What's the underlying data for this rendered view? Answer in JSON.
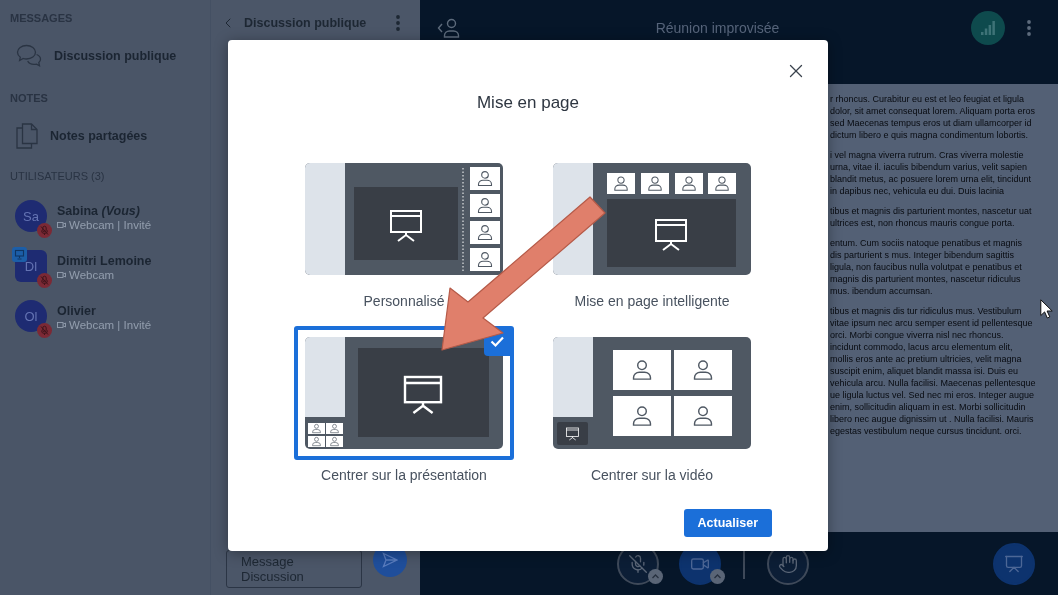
{
  "sidebar": {
    "sections": [
      {
        "title": "MESSAGES",
        "items": [
          {
            "kind": "chat",
            "label": "Discussion publique"
          }
        ]
      },
      {
        "title": "NOTES",
        "items": [
          {
            "kind": "notes",
            "label": "Notes partagées"
          }
        ]
      }
    ],
    "users_title": "UTILISATEURS (3)",
    "users": [
      {
        "initials": "Sa",
        "name": "Sabina *(Vous)*",
        "status": "Webcam | Invité",
        "moderator": false,
        "presenter": false,
        "muted": true
      },
      {
        "initials": "Dl",
        "name": "Dimitri Lemoine",
        "status": "Webcam",
        "moderator": true,
        "presenter": true,
        "muted": true
      },
      {
        "initials": "Ol",
        "name": "Olivier",
        "status": "Webcam | Invité",
        "moderator": false,
        "presenter": false,
        "muted": true
      }
    ]
  },
  "chat": {
    "title": "Discussion publique",
    "input": {
      "placeholder": "Message Discussion"
    }
  },
  "meeting": {
    "title": "Réunion improvisée"
  },
  "presentation": {
    "paragraphs": [
      "r rhoncus. Curabitur eu est et leo feugiat et ligula dolor, sit amet consequat lorem. Aliquam porta eros sed Maecenas tempus eros ut diam ullamcorper id dictum libero e quis magna condimentum lobortis.",
      "i vel magna viverra rutrum. Cras viverra molestie urna, vitae il. iaculis bibendum varius, velit sapien blandit metus, ac posuere lorem urna elit, tincidunt in dapibus nec, vehicula eu dui. Duis lacinia",
      "tibus et magnis dis parturient montes, nascetur uat ultrices est, non rhoncus mauris congue porta.",
      "entum. Cum sociis natoque penatibus et magnis dis parturient s mus. Integer bibendum sagittis ligula, non faucibus nulla volutpat e penatibus et magnis dis parturient montes, nascetur ridiculus mus. ibendum accumsan.",
      "tibus et magnis dis tur ridiculus mus. Vestibulum vitae ipsum nec arcu semper esent id pellentesque orci. Morbi congue viverra nisl nec rhoncus. incidunt commodo, lacus arcu elementum elit, mollis eros ante ac pretium ultricies, velit magna suscipit enim, aliquet blandit massa isi. Duis eu vehicula arcu. Nulla facilisi. Maecenas pellentesque ue ligula luctus vel. Sed nec mi eros. Integer augue enim, sollicitudin aliquam in est. Morbi sollicitudin libero nec augue dignissim ut . Nulla facilisi. Mauris egestas vestibulum neque cursus tincidunt. orci."
    ]
  },
  "controls": [
    {
      "kind": "mic",
      "on": false
    },
    {
      "kind": "camera",
      "on": true
    },
    {
      "kind": "hand",
      "on": false
    }
  ],
  "presentation_toggle": {
    "on": true
  },
  "dialog": {
    "title": "Mise en page",
    "options": [
      {
        "kind": "custom",
        "label": "Personnalisé",
        "selected": false
      },
      {
        "kind": "smart",
        "label": "Mise en page intelligente",
        "selected": false
      },
      {
        "kind": "presentation",
        "label": "Centrer sur la présentation",
        "selected": true
      },
      {
        "kind": "video",
        "label": "Centrer sur la vidéo",
        "selected": false
      }
    ],
    "submit": "Actualiser"
  }
}
